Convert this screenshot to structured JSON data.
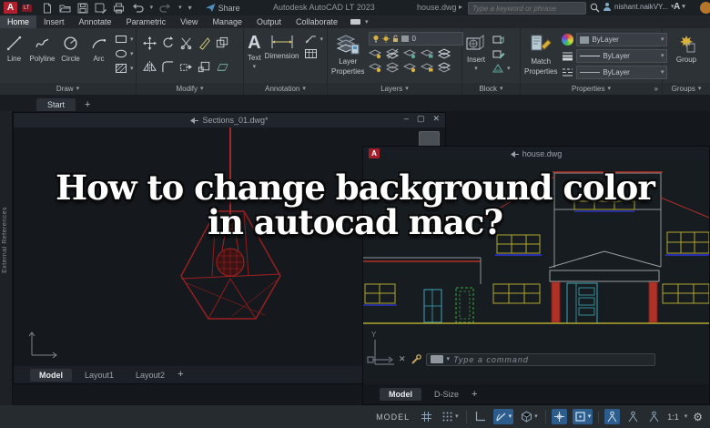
{
  "icons": {
    "dropdown": "▾",
    "plus": "+",
    "minimize": "–",
    "restore": "▢",
    "close": "✕",
    "gear": "⚙",
    "arrow_right": "▸",
    "expand": "»",
    "cross": "✕"
  },
  "titlebar": {
    "lt_badge": "LT",
    "share_label": "Share",
    "app_title": "Autodesk AutoCAD LT 2023",
    "doc_name": "house.dwg",
    "search_placeholder": "Type a keyword or phrase",
    "user_name": "nishant.naikVY...",
    "autodesk_initial": "A"
  },
  "ribbon": {
    "tabs": [
      "Home",
      "Insert",
      "Annotate",
      "Parametric",
      "View",
      "Manage",
      "Output",
      "Collaborate"
    ],
    "active_tab": "Home",
    "draw": {
      "title": "Draw",
      "tools": [
        "Line",
        "Polyline",
        "Circle",
        "Arc"
      ]
    },
    "modify": {
      "title": "Modify"
    },
    "annotation": {
      "title": "Annotation",
      "text_label": "Text",
      "dimension_label": "Dimension"
    },
    "layers": {
      "title": "Layers",
      "button_line1": "Layer",
      "button_line2": "Properties",
      "current_layer": "0"
    },
    "block": {
      "title": "Block",
      "insert_label": "Insert"
    },
    "properties": {
      "title": "Properties",
      "match_line1": "Match",
      "match_line2": "Properties",
      "color_value": "ByLayer",
      "lineweight_value": "ByLayer",
      "linetype_value": "ByLayer"
    },
    "groups": {
      "title": "Groups",
      "group_label": "Group"
    }
  },
  "file_tabs": {
    "start_label": "Start"
  },
  "palette": {
    "label": "External References"
  },
  "window1": {
    "title": "Sections_01.dwg*",
    "layout_tabs": [
      "Model",
      "Layout1",
      "Layout2"
    ],
    "active_layout": "Model"
  },
  "window2": {
    "title": "house.dwg",
    "command_placeholder": "Type a command",
    "layout_tabs": [
      "Model",
      "D-Size"
    ],
    "active_layout": "Model",
    "ucs_y_label": "Y"
  },
  "overlay": {
    "line1": "How to change background color",
    "line2": "in autocad mac?"
  },
  "statusbar": {
    "model_label": "MODEL",
    "annotation_scale": "1:1"
  },
  "colors": {
    "logo_red": "#b1202c",
    "canvas": "#14181c",
    "ribbon": "#2d3237",
    "accent_blue": "#2d5d8c",
    "drawing_red": "#a42323",
    "house_yellow": "#b2a62e",
    "house_cyan": "#3ba8b8",
    "house_blue": "#2a35c0",
    "house_green": "#3aa83a"
  }
}
